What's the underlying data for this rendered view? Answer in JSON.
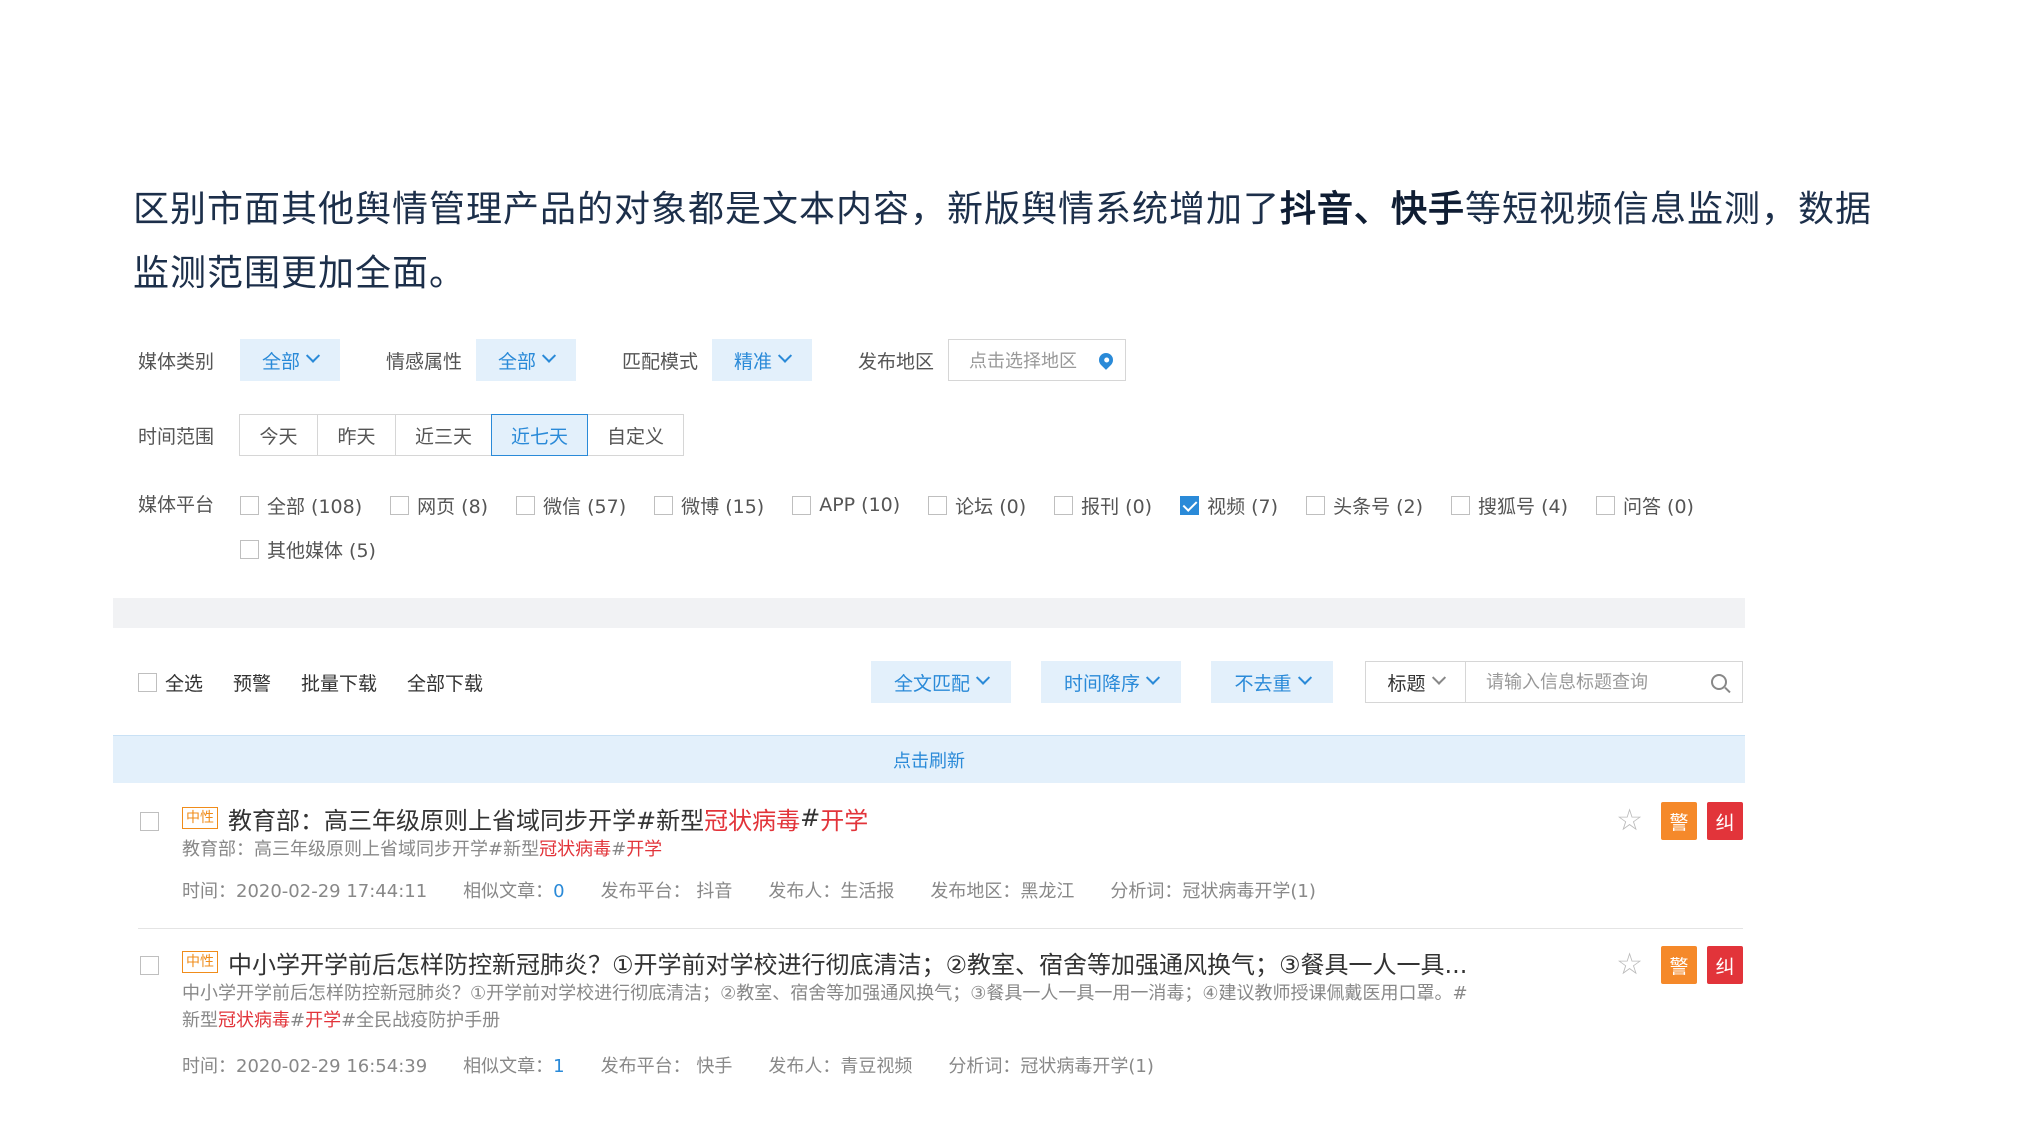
{
  "intro": {
    "part1": "区别市面其他舆情管理产品的对象都是文本内容，新版舆情系统增加了",
    "bold": "抖音、快手",
    "part2": "等短视频信息监测，数据监测范围更加全面。"
  },
  "filters": {
    "media_type": {
      "label": "媒体类别",
      "value": "全部"
    },
    "sentiment": {
      "label": "情感属性",
      "value": "全部"
    },
    "match_mode": {
      "label": "匹配模式",
      "value": "精准"
    },
    "region": {
      "label": "发布地区",
      "placeholder": "点击选择地区",
      "icon": "location-pin-icon"
    },
    "time_range": {
      "label": "时间范围",
      "options": [
        "今天",
        "昨天",
        "近三天",
        "近七天",
        "自定义"
      ],
      "selected": "近七天"
    },
    "platform": {
      "label": "媒体平台",
      "items": [
        {
          "label": "全部 (108)",
          "checked": false
        },
        {
          "label": "网页 (8)",
          "checked": false
        },
        {
          "label": "微信 (57)",
          "checked": false
        },
        {
          "label": "微博 (15)",
          "checked": false
        },
        {
          "label": "APP (10)",
          "checked": false
        },
        {
          "label": "论坛 (0)",
          "checked": false
        },
        {
          "label": "报刊 (0)",
          "checked": false
        },
        {
          "label": "视频 (7)",
          "checked": true
        },
        {
          "label": "头条号 (2)",
          "checked": false
        },
        {
          "label": "搜狐号 (4)",
          "checked": false
        },
        {
          "label": "问答 (0)",
          "checked": false
        },
        {
          "label": "其他媒体 (5)",
          "checked": false
        }
      ]
    }
  },
  "toolbar": {
    "select_all": "全选",
    "alert": "预警",
    "batch_download": "批量下载",
    "download_all": "全部下载",
    "match": "全文匹配",
    "sort": "时间降序",
    "dedupe": "不去重",
    "search_field": "标题",
    "search_placeholder": "请输入信息标题查询"
  },
  "refresh_label": "点击刷新",
  "results": [
    {
      "tag": "中性",
      "title_a": "教育部：高三年级原则上省域同步开学#新型",
      "title_red1": "冠状病毒",
      "title_b": " #",
      "title_red2": "开学",
      "summary_a": "教育部：高三年级原则上省域同步开学#新型",
      "summary_red1": "冠状病毒",
      "summary_b": "#",
      "summary_red2": "开学",
      "summary_c": "",
      "time": "时间：2020-02-29 17:44:11",
      "similar_label": "相似文章：",
      "similar_count": "0",
      "platform": "发布平台： 抖音",
      "publisher": "发布人：生活报",
      "region": "发布地区：黑龙江",
      "keywords": "分析词：冠状病毒开学(1)",
      "alert_btn": "警",
      "correct_btn": "纠"
    },
    {
      "tag": "中性",
      "title_a": "中小学开学前后怎样防控新冠肺炎？①开学前对学校进行彻底清洁；②教室、宿舍等加强通风换气；③餐具一人一具...",
      "title_red1": "",
      "title_b": "",
      "title_red2": "",
      "summary_a": "中小学开学前后怎样防控新冠肺炎？①开学前对学校进行彻底清洁；②教室、宿舍等加强通风换气；③餐具一人一具一用一消毒；④建议教师授课佩戴医用口罩。#新型",
      "summary_red1": "冠状病毒",
      "summary_b": "#",
      "summary_red2": "开学",
      "summary_c": "#全民战疫防护手册",
      "time": "时间：2020-02-29 16:54:39",
      "similar_label": "相似文章：",
      "similar_count": "1",
      "platform": "发布平台： 快手",
      "publisher": "发布人：青豆视频",
      "region": "",
      "keywords": "分析词：冠状病毒开学(1)",
      "alert_btn": "警",
      "correct_btn": "纠"
    }
  ],
  "colors": {
    "accent": "#2a8ad8",
    "accent_bg": "#e3f0fb",
    "warn": "#f5892a",
    "danger": "#e2343a"
  }
}
